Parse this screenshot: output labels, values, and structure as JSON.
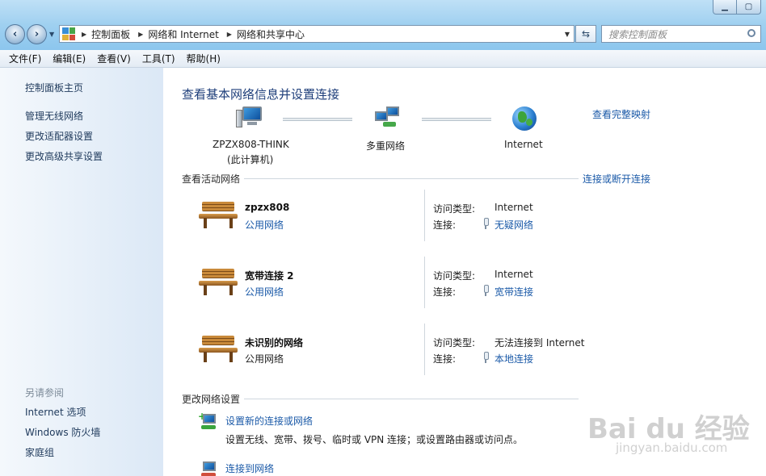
{
  "breadcrumb": [
    "控制面板",
    "网络和 Internet",
    "网络和共享中心"
  ],
  "search": {
    "placeholder": "搜索控制面板"
  },
  "menu": [
    "文件(F)",
    "编辑(E)",
    "查看(V)",
    "工具(T)",
    "帮助(H)"
  ],
  "sidebar": {
    "home": "控制面板主页",
    "links": [
      "管理无线网络",
      "更改适配器设置",
      "更改高级共享设置"
    ],
    "see_also_title": "另请参阅",
    "see_also": [
      "Internet 选项",
      "Windows 防火墙",
      "家庭组"
    ]
  },
  "main": {
    "title": "查看基本网络信息并设置连接",
    "view_full_map": "查看完整映射",
    "map": {
      "computer_name": "ZPZX808-THINK",
      "computer_sub": "(此计算机)",
      "middle": "多重网络",
      "internet": "Internet"
    },
    "active_title": "查看活动网络",
    "connect_link": "连接或断开连接",
    "networks": [
      {
        "name": "zpzx808",
        "type": "公用网络",
        "type_is_link": true,
        "access_label": "访问类型:",
        "access": "Internet",
        "conn_label": "连接:",
        "conn": "无疑网络"
      },
      {
        "name": "宽带连接  2",
        "type": "公用网络",
        "type_is_link": true,
        "access_label": "访问类型:",
        "access": "Internet",
        "conn_label": "连接:",
        "conn": "宽带连接"
      },
      {
        "name": "未识别的网络",
        "type": "公用网络",
        "type_is_link": false,
        "access_label": "访问类型:",
        "access": "无法连接到 Internet",
        "conn_label": "连接:",
        "conn": "本地连接"
      }
    ],
    "change_title": "更改网络设置",
    "tasks": [
      {
        "link": "设置新的连接或网络",
        "desc": "设置无线、宽带、拨号、临时或 VPN 连接；或设置路由器或访问点。"
      },
      {
        "link": "连接到网络"
      }
    ]
  },
  "watermark": {
    "brand": "Bai du 经验",
    "url": "jingyan.baidu.com"
  }
}
